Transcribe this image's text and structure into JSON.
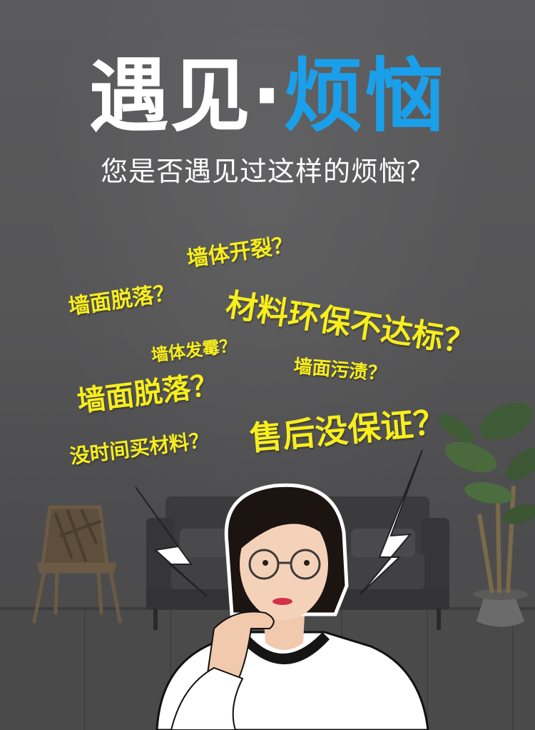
{
  "header": {
    "title_part1": "遇见·",
    "title_part2": "烦恼",
    "subtitle": "您是否遇见过这样的烦恼？"
  },
  "problems": [
    "墙体开裂？",
    "墙面脱落？",
    "材料环保不达标？",
    "墙体发霉？",
    "墙面污渍？",
    "墙面脱落？",
    "售后没保证？",
    "没时间买材料？"
  ],
  "colors": {
    "title_white": "#ffffff",
    "title_blue": "#1aa0ea",
    "problem_yellow": "#f7ee1c",
    "background": "#555556"
  },
  "icons": {
    "chair": "chair-icon",
    "sofa": "sofa-icon",
    "plant": "plant-icon",
    "woman": "woman-figure"
  }
}
